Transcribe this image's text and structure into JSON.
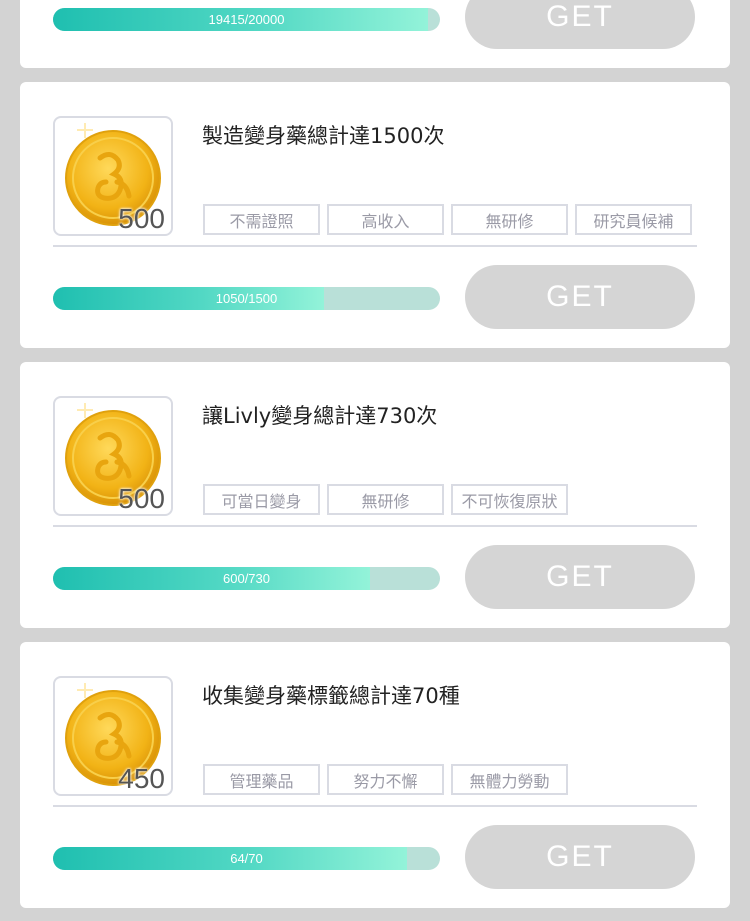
{
  "colors": {
    "background": "#d3d3d3",
    "card": "#ffffff",
    "progress_fill": "#2cc6b4",
    "progress_track": "#b9e0d8",
    "button": "#d5d5d5",
    "coin": "#f2b316"
  },
  "missions": [
    {
      "progress_text": "19415/20000",
      "progress": 0.97,
      "button_label": "GET"
    },
    {
      "icon": "gold-coin-icon",
      "reward": "500",
      "title": "製造變身藥總計達1500次",
      "tags": [
        "不需證照",
        "高收入",
        "無研修",
        "研究員候補"
      ],
      "progress_text": "1050/1500",
      "progress": 0.7,
      "button_label": "GET"
    },
    {
      "icon": "gold-coin-icon",
      "reward": "500",
      "title": "讓Livly變身總計達730次",
      "tags": [
        "可當日變身",
        "無研修",
        "不可恢復原狀"
      ],
      "progress_text": "600/730",
      "progress": 0.82,
      "button_label": "GET"
    },
    {
      "icon": "gold-coin-icon",
      "reward": "450",
      "title": "收集變身藥標籤總計達70種",
      "tags": [
        "管理藥品",
        "努力不懈",
        "無體力勞動"
      ],
      "progress_text": "64/70",
      "progress": 0.914,
      "button_label": "GET"
    }
  ]
}
